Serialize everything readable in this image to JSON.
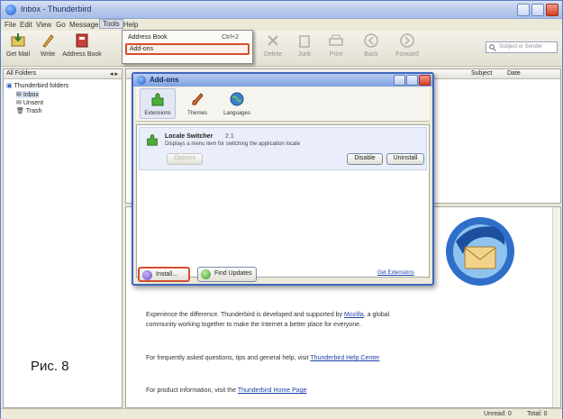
{
  "window": {
    "title": "Inbox - Thunderbird"
  },
  "menubar": {
    "items": [
      "File",
      "Edit",
      "View",
      "Go",
      "Message",
      "Tools",
      "Help"
    ]
  },
  "toolbar": {
    "buttons": [
      {
        "label": "Get Mail",
        "icon": "get-mail-icon"
      },
      {
        "label": "Write",
        "icon": "write-icon"
      },
      {
        "label": "Address Book",
        "icon": "address-book-icon"
      }
    ],
    "right_buttons": [
      "Delete",
      "Junk",
      "Print",
      "Back",
      "Forward"
    ],
    "search_placeholder": "Subject or Sender"
  },
  "tools_menu": {
    "items": [
      {
        "label": "Address Book",
        "shortcut": "Ctrl+2"
      },
      {
        "label": "Add-ons",
        "shortcut": ""
      }
    ]
  },
  "folders": {
    "header": "All Folders",
    "account": "Thunderbird folders",
    "items": [
      "Inbox",
      "Unsent",
      "Trash"
    ]
  },
  "message_list": {
    "columns": [
      "Subject",
      "Date"
    ]
  },
  "addons_dialog": {
    "title": "Add-ons",
    "tabs": [
      "Extensions",
      "Themes",
      "Languages"
    ],
    "addon": {
      "name": "Locale Switcher",
      "version": "2.1",
      "description": "Displays a menu item for switching the application locale",
      "options_label": "Options",
      "disable_label": "Disable",
      "uninstall_label": "Uninstall"
    },
    "install_label": "Install...",
    "find_updates_label": "Find Updates",
    "get_extensions_link": "Get Extensions"
  },
  "start_page": {
    "para1_a": "Experience the difference. Thunderbird is developed and supported by",
    "para1_link": "Mozilla",
    "para1_b": ", a global community working together to make the Internet a better",
    "para1_c": "place for everyone.",
    "para2_a": "For frequently asked questions, tips and general help, visit",
    "para2_link": "Thunderbird Help Center",
    "para3_a": "For product information, visit the",
    "para3_link": "Thunderbird Home Page"
  },
  "statusbar": {
    "unread": "Unread: 0",
    "total": "Total: 0"
  },
  "caption": "Рис. 8",
  "colors": {
    "highlight": "#d2502f",
    "titlebar": "#a8bde6",
    "link": "#1b3fa8"
  }
}
